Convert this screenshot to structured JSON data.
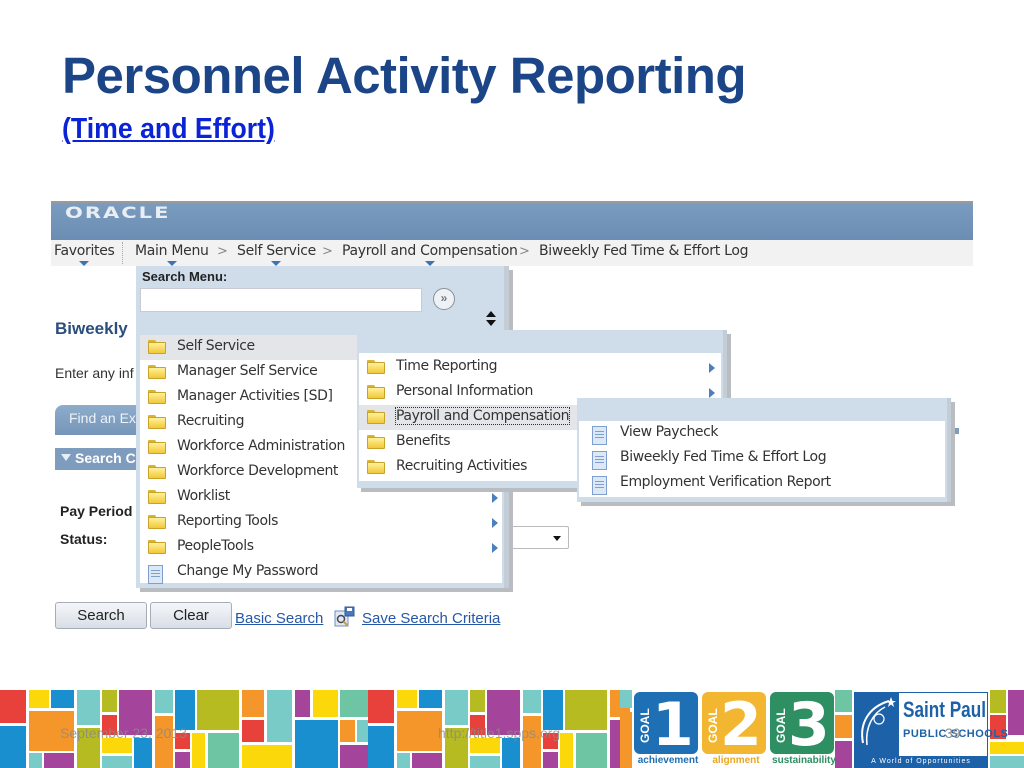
{
  "slide": {
    "title": "Personnel Activity Reporting",
    "subtitle": "(Time and Effort)"
  },
  "oracle": {
    "logo": "ORACLE",
    "nav": {
      "favorites": "Favorites",
      "main_menu": "Main Menu",
      "separator": ">",
      "breadcrumbs": [
        "Self Service",
        "Payroll and Compensation",
        "Biweekly Fed Time & Effort Log"
      ]
    },
    "page": {
      "heading": "Biweekly",
      "instructions": "Enter any inf",
      "find_tab": "Find an Ex",
      "search_criteria": "Search C",
      "pay_period_label": "Pay Period",
      "status_label": "Status:",
      "status_value": "",
      "search_button": "Search",
      "clear_button": "Clear",
      "basic_search_link": "Basic Search",
      "save_search_link": "Save Search Criteria"
    },
    "search_menu": {
      "label": "Search Menu:",
      "input_value": "",
      "go_icon": "»"
    },
    "main_menu_items": [
      {
        "label": "Self Service",
        "icon": "folder-icon",
        "submenu": true,
        "highlighted": true
      },
      {
        "label": "Manager Self Service",
        "icon": "folder-icon",
        "submenu": true
      },
      {
        "label": "Manager Activities [SD]",
        "icon": "folder-icon",
        "submenu": true
      },
      {
        "label": "Recruiting",
        "icon": "folder-icon",
        "submenu": true
      },
      {
        "label": "Workforce Administration",
        "icon": "folder-icon",
        "submenu": true
      },
      {
        "label": "Workforce Development",
        "icon": "folder-icon",
        "submenu": true
      },
      {
        "label": "Worklist",
        "icon": "folder-icon",
        "submenu": true
      },
      {
        "label": "Reporting Tools",
        "icon": "folder-icon",
        "submenu": true
      },
      {
        "label": "PeopleTools",
        "icon": "folder-icon",
        "submenu": true
      },
      {
        "label": "Change My Password",
        "icon": "document-icon",
        "submenu": false
      }
    ],
    "self_service_items": [
      {
        "label": "Time Reporting",
        "icon": "folder-icon",
        "submenu": true
      },
      {
        "label": "Personal Information",
        "icon": "folder-icon",
        "submenu": true
      },
      {
        "label": "Payroll and Compensation",
        "icon": "folder-icon",
        "submenu": true,
        "highlighted": true
      },
      {
        "label": "Benefits",
        "icon": "folder-icon",
        "submenu": true
      },
      {
        "label": "Recruiting Activities",
        "icon": "folder-icon",
        "submenu": true
      }
    ],
    "payroll_items": [
      {
        "label": "View Paycheck",
        "icon": "document-icon"
      },
      {
        "label": "Biweekly Fed Time & Effort Log",
        "icon": "document-icon"
      },
      {
        "label": "Employment Verification Report",
        "icon": "document-icon"
      }
    ]
  },
  "footer": {
    "date": "September 23, 2013",
    "url": "http://title1.spps.org",
    "page_number": "39",
    "goals": [
      {
        "word": "GOAL",
        "number": "1",
        "caption": "achievement",
        "color": "#1f6fb5",
        "caption_color": "#1f6fb5"
      },
      {
        "word": "GOAL",
        "number": "2",
        "caption": "alignment",
        "color": "#f2b630",
        "caption_color": "#e9a820"
      },
      {
        "word": "GOAL",
        "number": "3",
        "caption": "sustainability",
        "color": "#2e8f63",
        "caption_color": "#2e8f63"
      }
    ],
    "school_logo": {
      "line1": "Saint Paul",
      "line2": "PUBLIC SCHOOLS",
      "tagline": "A World of Opportunities"
    }
  },
  "colors": {
    "title": "#1c4587",
    "subtitle_link": "#0b23d6",
    "oracle_header": "#7396ba",
    "menu_panel": "#cfdcea",
    "link": "#2557a7"
  }
}
